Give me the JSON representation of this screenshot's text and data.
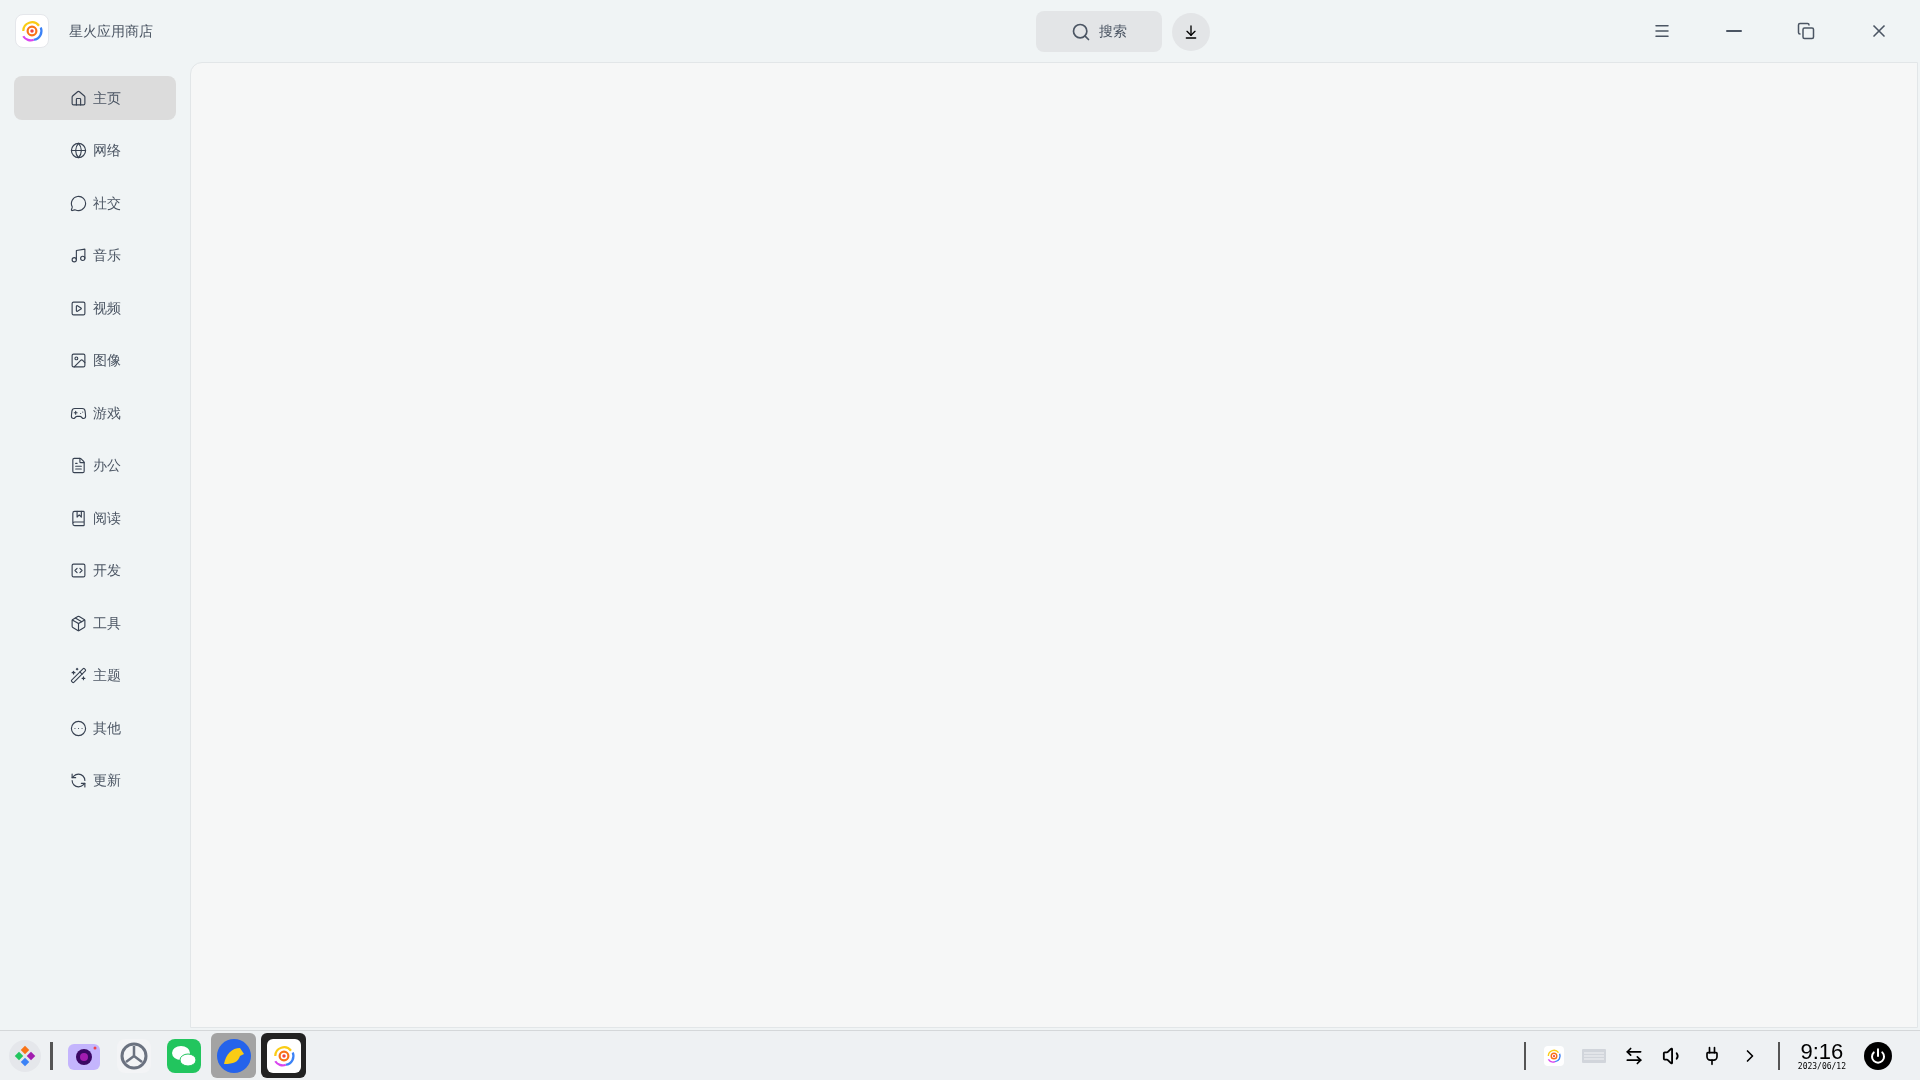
{
  "window": {
    "title": "星火应用商店"
  },
  "search": {
    "label": "搜索"
  },
  "sidebar": {
    "items": [
      {
        "kind": "home",
        "label": "主页",
        "selected": true
      },
      {
        "kind": "network",
        "label": "网络",
        "selected": false
      },
      {
        "kind": "social",
        "label": "社交",
        "selected": false
      },
      {
        "kind": "music",
        "label": "音乐",
        "selected": false
      },
      {
        "kind": "video",
        "label": "视频",
        "selected": false
      },
      {
        "kind": "image",
        "label": "图像",
        "selected": false
      },
      {
        "kind": "game",
        "label": "游戏",
        "selected": false
      },
      {
        "kind": "office",
        "label": "办公",
        "selected": false
      },
      {
        "kind": "reading",
        "label": "阅读",
        "selected": false
      },
      {
        "kind": "dev",
        "label": "开发",
        "selected": false
      },
      {
        "kind": "tools",
        "label": "工具",
        "selected": false
      },
      {
        "kind": "theme",
        "label": "主题",
        "selected": false
      },
      {
        "kind": "other",
        "label": "其他",
        "selected": false
      },
      {
        "kind": "update",
        "label": "更新",
        "selected": false
      }
    ]
  },
  "taskbar": {
    "apps": [
      {
        "kind": "camera",
        "selected": false
      },
      {
        "kind": "settings",
        "selected": false
      },
      {
        "kind": "chat",
        "selected": false
      },
      {
        "kind": "browser",
        "selected": true
      },
      {
        "kind": "store",
        "selected": false
      }
    ],
    "time": "9:16",
    "date": "2023/06/12"
  }
}
